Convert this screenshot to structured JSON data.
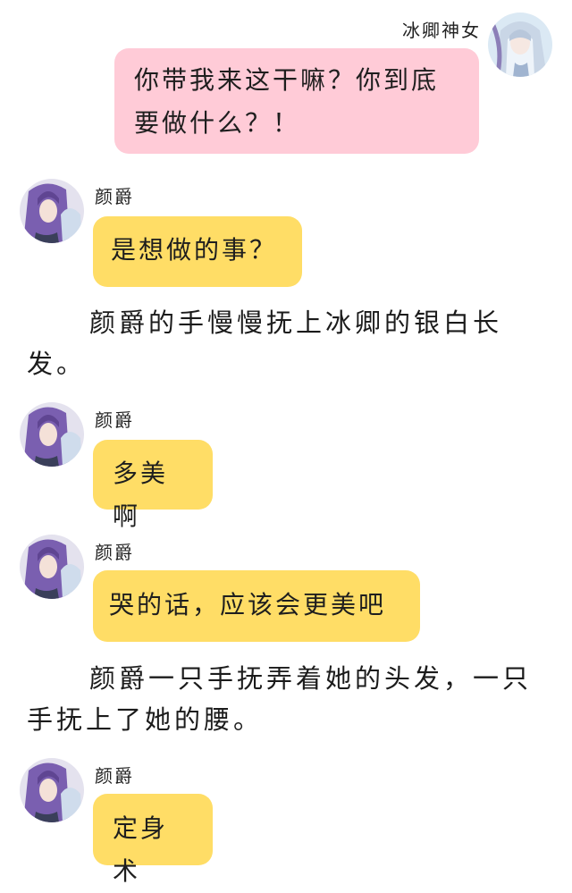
{
  "messages": [
    {
      "speaker": "冰卿神女",
      "text": "你带我来这干嘛？你到底要做什么？！",
      "side": "right",
      "color": "#ffcbd7"
    },
    {
      "speaker": "颜爵",
      "text": "是想做的事？",
      "side": "left",
      "color": "#ffdd66"
    },
    {
      "speaker": "颜爵",
      "text": "多美啊",
      "side": "left",
      "color": "#ffdd66"
    },
    {
      "speaker": "颜爵",
      "text": "哭的话，应该会更美吧",
      "side": "left",
      "color": "#ffdd66"
    },
    {
      "speaker": "颜爵",
      "text": "定身术",
      "side": "left",
      "color": "#ffdd66"
    }
  ],
  "narrations": [
    "颜爵的手慢慢抚上冰卿的银白长发。",
    "颜爵一只手抚弄着她的头发，一只手抚上了她的腰。"
  ],
  "avatars": {
    "bingqing": "avatar-silver-haired-girl",
    "yanjue": "avatar-purple-haired-man"
  }
}
